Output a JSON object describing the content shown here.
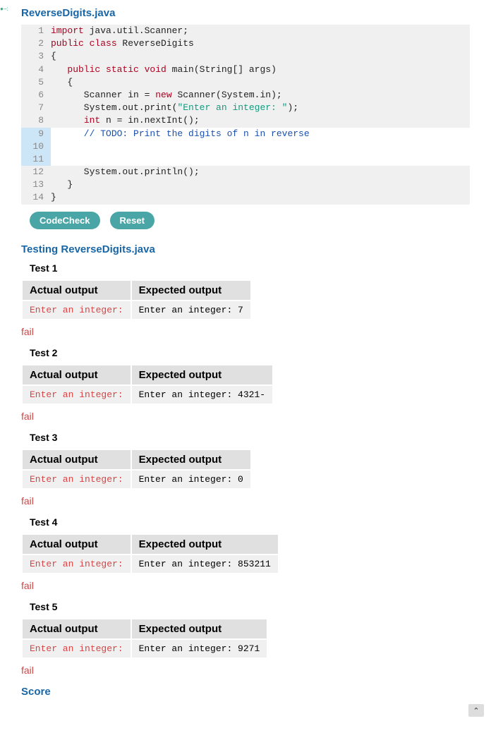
{
  "corner_icon": "●–:",
  "file_title": "ReverseDigits.java",
  "code": [
    {
      "n": 1,
      "hl": false,
      "tokens": [
        {
          "t": "import ",
          "c": "kw-red"
        },
        {
          "t": "java.util.Scanner;",
          "c": "plain"
        }
      ]
    },
    {
      "n": 2,
      "hl": false,
      "tokens": [
        {
          "t": "public class ",
          "c": "kw-red"
        },
        {
          "t": "ReverseDigits",
          "c": "plain"
        }
      ]
    },
    {
      "n": 3,
      "hl": false,
      "tokens": [
        {
          "t": "{",
          "c": "plain"
        }
      ]
    },
    {
      "n": 4,
      "hl": false,
      "tokens": [
        {
          "t": "   ",
          "c": "plain"
        },
        {
          "t": "public static void ",
          "c": "kw-red"
        },
        {
          "t": "main(String[] args)",
          "c": "plain"
        }
      ]
    },
    {
      "n": 5,
      "hl": false,
      "tokens": [
        {
          "t": "   {",
          "c": "plain"
        }
      ]
    },
    {
      "n": 6,
      "hl": false,
      "tokens": [
        {
          "t": "      Scanner in = ",
          "c": "plain"
        },
        {
          "t": "new ",
          "c": "kw-red"
        },
        {
          "t": "Scanner(System.in);",
          "c": "plain"
        }
      ]
    },
    {
      "n": 7,
      "hl": false,
      "tokens": [
        {
          "t": "      System.out.print(",
          "c": "plain"
        },
        {
          "t": "\"Enter an integer: \"",
          "c": "kw-green"
        },
        {
          "t": ");",
          "c": "plain"
        }
      ]
    },
    {
      "n": 8,
      "hl": false,
      "tokens": [
        {
          "t": "      ",
          "c": "plain"
        },
        {
          "t": "int ",
          "c": "kw-red"
        },
        {
          "t": "n = in.nextInt();",
          "c": "plain"
        }
      ]
    },
    {
      "n": 9,
      "hl": true,
      "tokens": [
        {
          "t": "      // TODO: Print the digits of n in reverse",
          "c": "kw-blue"
        }
      ]
    },
    {
      "n": 10,
      "hl": true,
      "tokens": [
        {
          "t": "",
          "c": "plain"
        }
      ]
    },
    {
      "n": 11,
      "hl": true,
      "tokens": [
        {
          "t": "",
          "c": "plain"
        }
      ]
    },
    {
      "n": 12,
      "hl": false,
      "tokens": [
        {
          "t": "      System.out.println();",
          "c": "plain"
        }
      ]
    },
    {
      "n": 13,
      "hl": false,
      "tokens": [
        {
          "t": "   }",
          "c": "plain"
        }
      ]
    },
    {
      "n": 14,
      "hl": false,
      "tokens": [
        {
          "t": "}",
          "c": "plain"
        }
      ]
    }
  ],
  "buttons": {
    "codecheck": "CodeCheck",
    "reset": "Reset"
  },
  "testing_title": "Testing ReverseDigits.java",
  "headers": {
    "actual": "Actual output",
    "expected": "Expected output"
  },
  "fail_text": "fail",
  "tests": [
    {
      "label": "Test 1",
      "actual": "Enter an integer: ",
      "expected": "Enter an integer: 7"
    },
    {
      "label": "Test 2",
      "actual": "Enter an integer: ",
      "expected": "Enter an integer: 4321-"
    },
    {
      "label": "Test 3",
      "actual": "Enter an integer: ",
      "expected": "Enter an integer: 0"
    },
    {
      "label": "Test 4",
      "actual": "Enter an integer: ",
      "expected": "Enter an integer: 853211"
    },
    {
      "label": "Test 5",
      "actual": "Enter an integer: ",
      "expected": "Enter an integer: 9271"
    }
  ],
  "score_title": "Score",
  "scroll_top_icon": "⌃"
}
